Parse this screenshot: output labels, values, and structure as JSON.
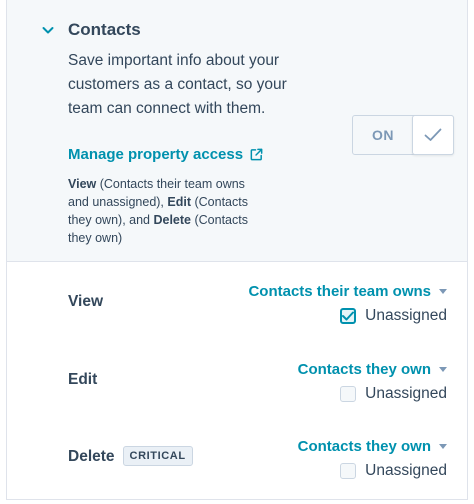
{
  "section": {
    "title": "Contacts",
    "description": "Save important info about your customers as a contact, so your team can connect with them.",
    "manage_link": "Manage property access",
    "note": {
      "view_label": "View",
      "view_text": " (Contacts their team owns and unassigned), ",
      "edit_label": "Edit",
      "edit_text": " (Contacts they own), and ",
      "delete_label": "Delete",
      "delete_text": " (Contacts they own)"
    },
    "toggle_label": "ON"
  },
  "permissions": [
    {
      "label": "View",
      "scope": "Contacts their team owns",
      "checkbox_label": "Unassigned",
      "checked": true
    },
    {
      "label": "Edit",
      "scope": "Contacts they own",
      "checkbox_label": "Unassigned",
      "checked": false
    },
    {
      "label": "Delete",
      "badge": "CRITICAL",
      "scope": "Contacts they own",
      "checkbox_label": "Unassigned",
      "checked": false
    }
  ],
  "colors": {
    "accent": "#0091ae",
    "text": "#33475b",
    "muted": "#7c98b6",
    "border": "#cbd6e2"
  }
}
